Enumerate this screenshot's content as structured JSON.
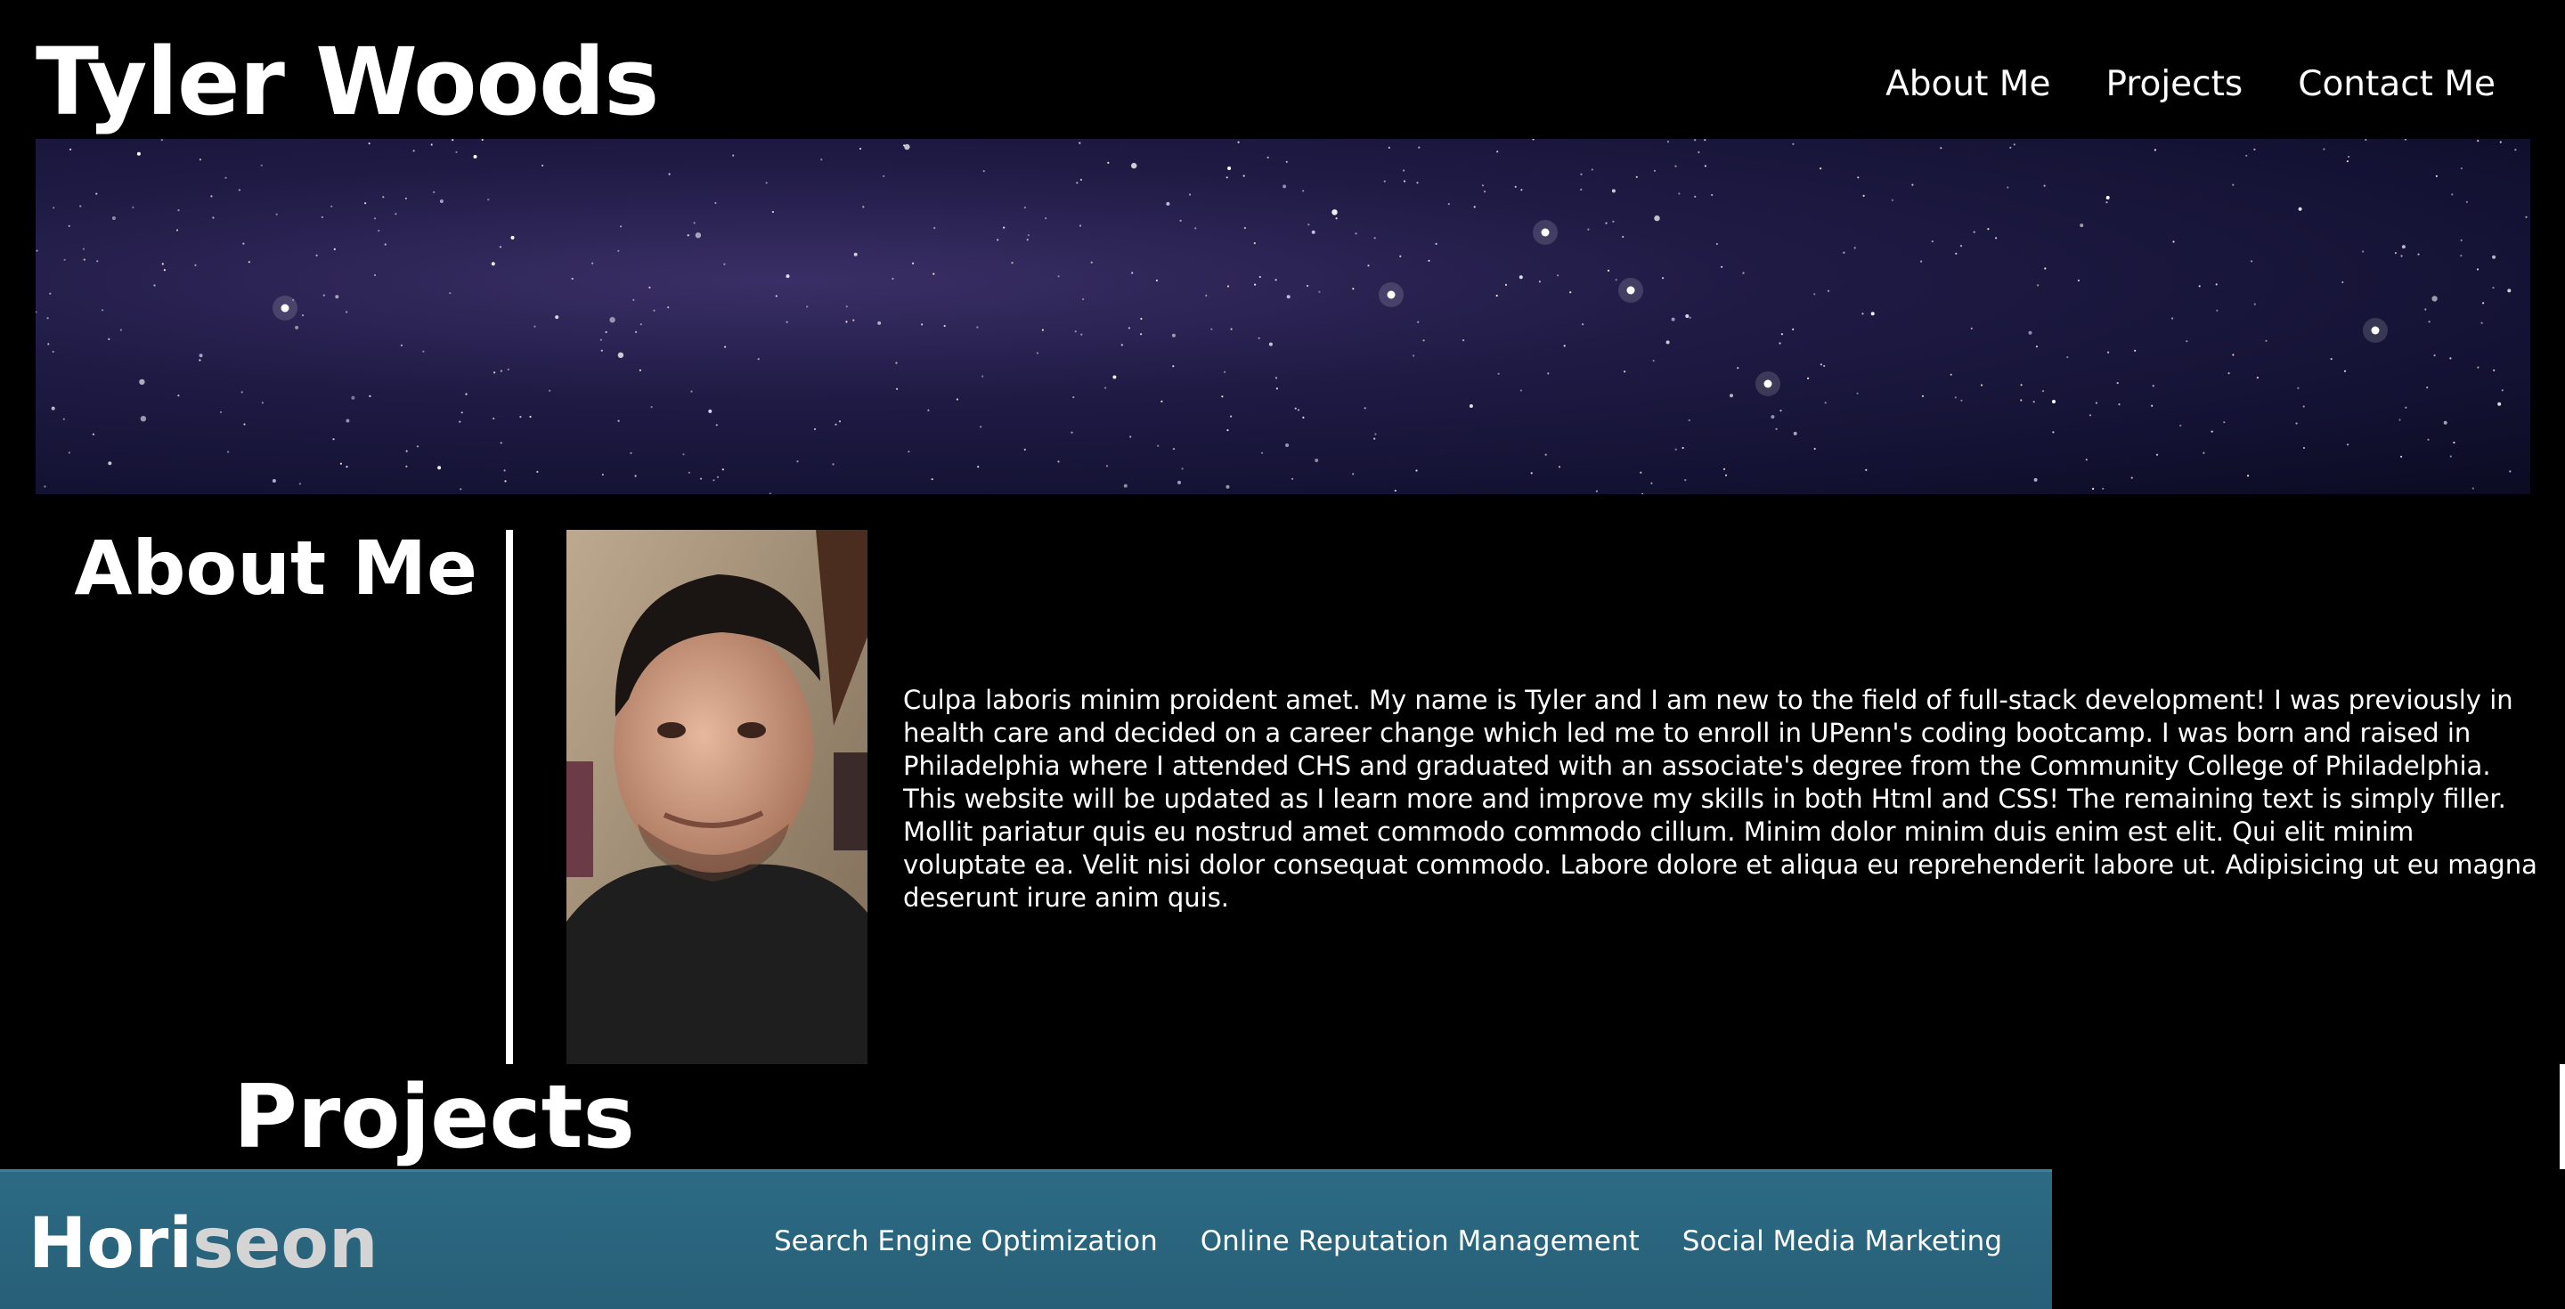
{
  "header": {
    "title": "Tyler Woods",
    "nav": [
      "About Me",
      "Projects",
      "Contact Me"
    ]
  },
  "about": {
    "heading": "About Me",
    "portrait_icon": "profile-photo",
    "text": "Culpa laboris minim proident amet. My name is Tyler and I am new to the field of full-stack development! I was previously in health care and decided on a career change which led me to enroll in UPenn's coding bootcamp. I was born and raised in Philadelphia where I attended CHS and graduated with an associate's degree from the Community College of Philadelphia. This website will be updated as I learn more and improve my skills in both Html and CSS! The remaining text is simply filler. Mollit pariatur quis eu nostrud amet commodo commodo cillum. Minim dolor minim duis enim est elit. Qui elit minim voluptate ea. Velit nisi dolor consequat commodo. Labore dolore et aliqua eu reprehenderit labore ut. Adipisicing ut eu magna deserunt irure anim quis."
  },
  "projects": {
    "heading": "Projects"
  },
  "footer": {
    "brand_part1": "Hori",
    "brand_part2": "seon",
    "nav": [
      "Search Engine Optimization",
      "Online Reputation Management",
      "Social Media Marketing"
    ]
  },
  "colors": {
    "background": "#000000",
    "footer_bar": "#2c6a84",
    "hero_sky": "#1f1a44"
  }
}
